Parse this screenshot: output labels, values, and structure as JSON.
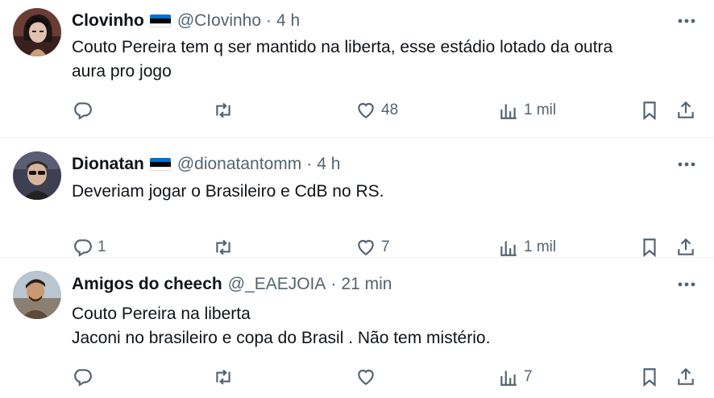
{
  "colors": {
    "text": "#0f1419",
    "secondary": "#536471",
    "divider": "#eff3f4",
    "flag_blue": "#0072ce",
    "flag_black": "#000000",
    "flag_white": "#ffffff"
  },
  "tweets": [
    {
      "name": "Clovinho",
      "flag_icon": "estonia-flag-icon",
      "handle": "@CIovinho",
      "dot": "·",
      "time": "4 h",
      "text_lines": [
        "Couto Pereira tem q ser mantido na liberta, esse estádio lotado da outra",
        "aura pro jogo"
      ],
      "replies": "",
      "retweets": "",
      "likes": "48",
      "views": "1 mil"
    },
    {
      "name": "Dionatan",
      "flag_icon": "estonia-flag-icon",
      "handle": "@dionatantomm",
      "dot": "·",
      "time": "4 h",
      "text_lines": [
        "Deveriam jogar o Brasileiro e CdB no RS."
      ],
      "replies": "1",
      "retweets": "",
      "likes": "7",
      "views": "1 mil"
    },
    {
      "name": "Amigos do cheech",
      "handle": "@_EAEJOIA",
      "dot": "·",
      "time": "21 min",
      "text_lines": [
        "Couto Pereira na liberta",
        "Jaconi no brasileiro e copa do Brasil . Não tem mistério."
      ],
      "replies": "",
      "retweets": "",
      "likes": "",
      "views": "7"
    }
  ]
}
